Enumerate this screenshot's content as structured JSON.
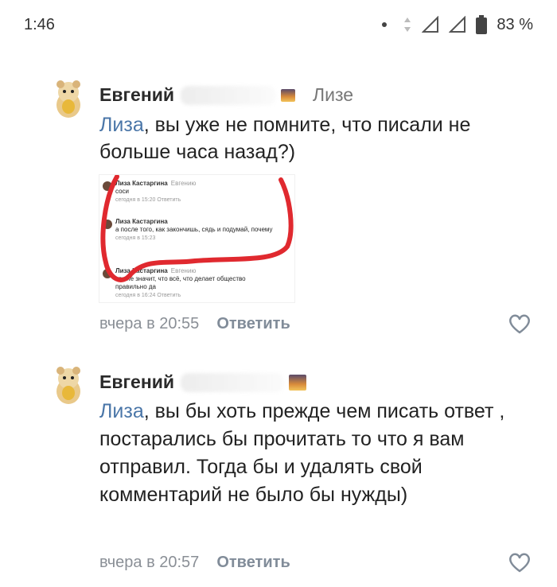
{
  "status_bar": {
    "time": "1:46",
    "battery": "83 %"
  },
  "comments": [
    {
      "author": "Евгений",
      "reply_to": "Лизе",
      "mention": "Лиза",
      "text": ", вы уже не помните, что писали не больше часа назад?)",
      "time": "вчера в 20:55",
      "reply_label": "Ответить",
      "attachment": {
        "rows": [
          {
            "name": "Лиза Кастаргина",
            "to": "Евгению",
            "text": "соси",
            "time": "сегодня в 15:20  Ответить"
          },
          {
            "name": "Лиза Кастаргина",
            "to": "",
            "text": "а после того, как закончишь, сядь и подумай, почему",
            "time": "сегодня в 15:23"
          },
          {
            "name": "Лиза Кастаргина",
            "to": "Евгению",
            "text": "это не значит, что всё, что делает общество правильно да",
            "time": "сегодня в 16:24  Ответить"
          }
        ]
      }
    },
    {
      "author": "Евгений",
      "reply_to": "",
      "mention": "Лиза",
      "text": ", вы бы хоть прежде чем писать ответ , постарались бы прочитать то что я вам отправил. Тогда бы и удалять свой комментарий не было бы нужды)",
      "time": "вчера в 20:57",
      "reply_label": "Ответить"
    }
  ],
  "colors": {
    "mention": "#4a76a8",
    "meta": "#8a8f96",
    "highlight": "#e0292f"
  }
}
